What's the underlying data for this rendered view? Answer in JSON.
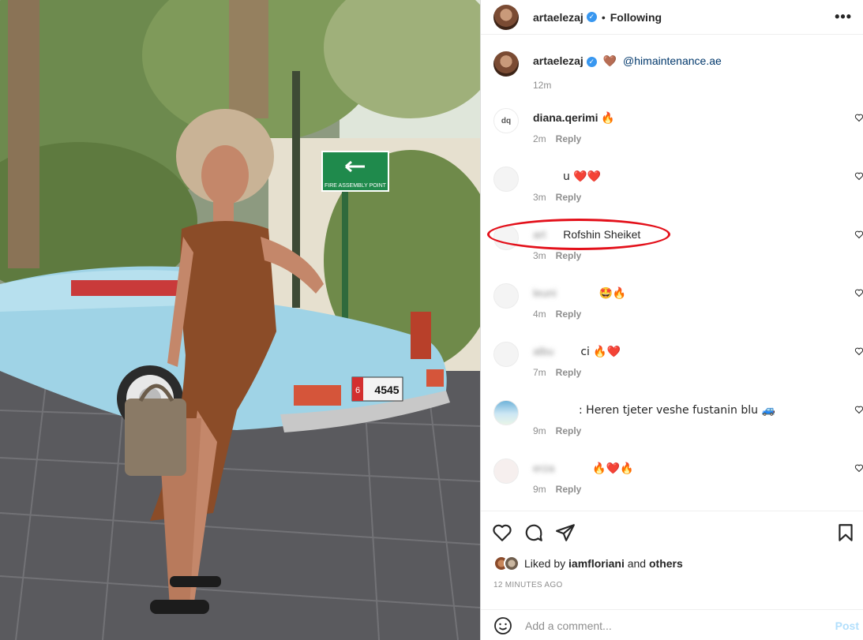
{
  "header": {
    "username": "artaelezaj",
    "follow_status": "Following",
    "more_icon": "more-options-icon"
  },
  "caption": {
    "username": "artaelezaj",
    "emoji": "🤎",
    "mention": "@himaintenance.ae",
    "time": "12m"
  },
  "photo": {
    "sign_text": "FIRE ASSEMBLY POINT",
    "plate_number": "4545",
    "plate_prefix": "6"
  },
  "comments": [
    {
      "user": "diana.qerimi",
      "text": "🔥",
      "time": "2m",
      "reply": "Reply"
    },
    {
      "user": "",
      "text": "u ❤️❤️",
      "time": "3m",
      "reply": "Reply"
    },
    {
      "user": "art",
      "text": "Rofshin Sheiket",
      "time": "3m",
      "reply": "Reply"
    },
    {
      "user": "leuni",
      "text": "🤩🔥",
      "time": "4m",
      "reply": "Reply"
    },
    {
      "user": "albu",
      "text": "ci 🔥❤️",
      "time": "7m",
      "reply": "Reply"
    },
    {
      "user": "",
      "text": ": Heren tjeter veshe fustanin blu 🚙",
      "time": "9m",
      "reply": "Reply"
    },
    {
      "user": "erza",
      "text": "🔥❤️🔥",
      "time": "9m",
      "reply": "Reply"
    }
  ],
  "actions": {
    "liked_by_prefix": "Liked by",
    "liked_by_user": "iamfloriani",
    "liked_by_and": "and",
    "liked_by_others": "others",
    "timestamp": "12 MINUTES AGO",
    "comment_placeholder": "Add a comment...",
    "post_label": "Post"
  }
}
